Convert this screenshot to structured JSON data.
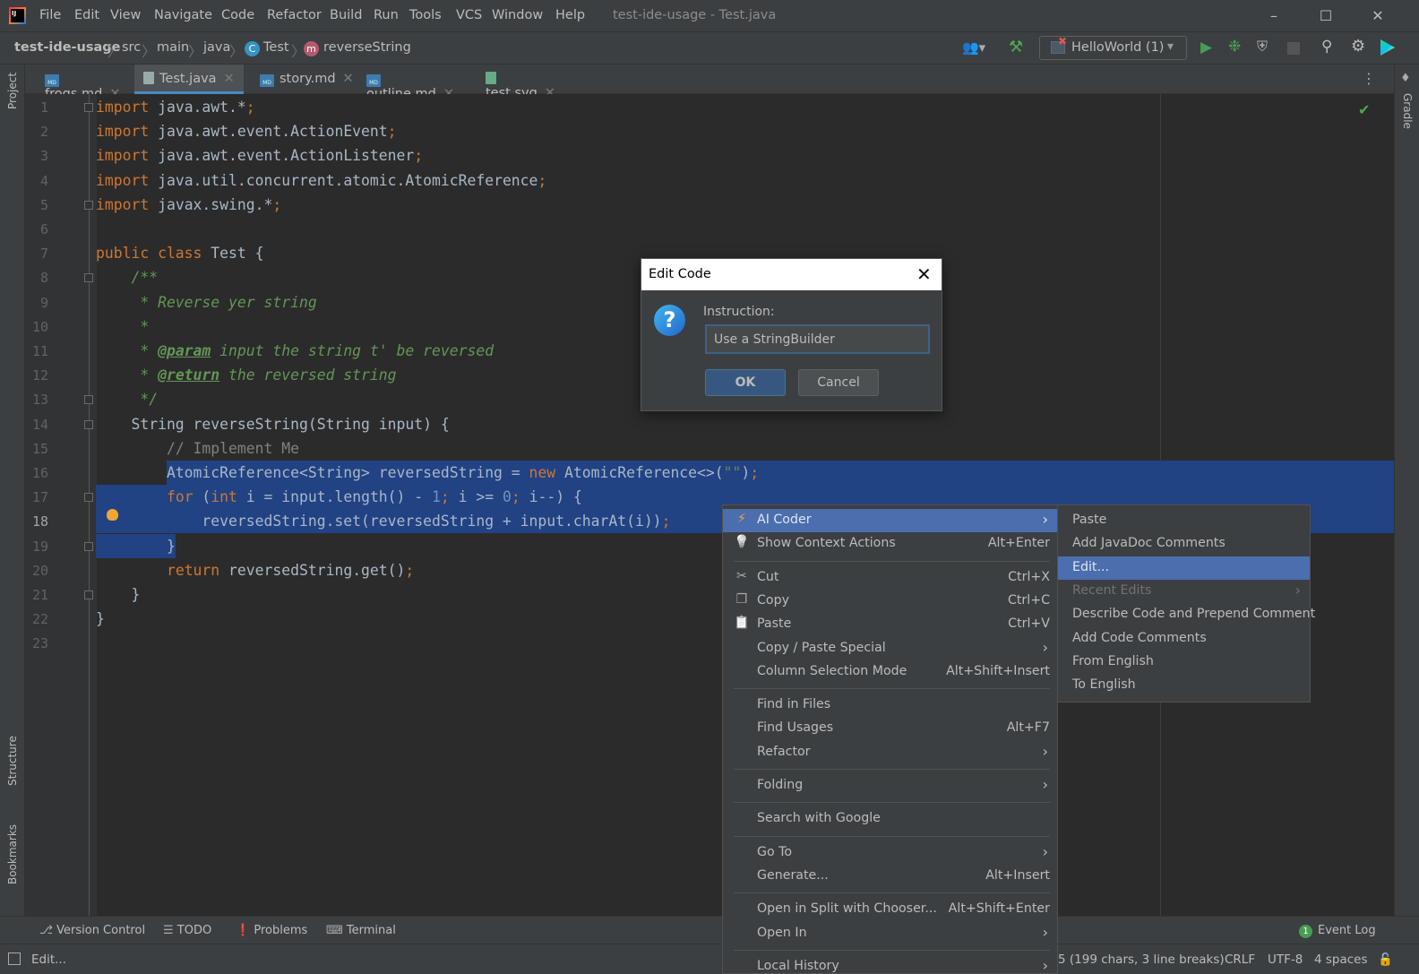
{
  "titlebar": {
    "menus": [
      "File",
      "Edit",
      "View",
      "Navigate",
      "Code",
      "Refactor",
      "Build",
      "Run",
      "Tools",
      "VCS",
      "Window",
      "Help"
    ],
    "title": "test-ide-usage - Test.java",
    "logo": "IJ"
  },
  "breadcrumb": {
    "project": "test-ide-usage",
    "items": [
      "src",
      "main",
      "java"
    ],
    "class_badge": "C",
    "class": "Test",
    "method_badge": "m",
    "method": "reverseString"
  },
  "toolbar": {
    "run_config": "HelloWorld (1)",
    "icons": [
      "user-icon",
      "build-hammer-icon",
      "run-icon",
      "debug-icon",
      "coverage-icon",
      "stop-icon",
      "search-icon",
      "gear-icon",
      "code-with-me-icon"
    ]
  },
  "tabs": [
    {
      "label": "frogs.md",
      "type": "md"
    },
    {
      "label": "Test.java",
      "type": "java",
      "active": true
    },
    {
      "label": "story.md",
      "type": "md"
    },
    {
      "label": "outline.md",
      "type": "md"
    },
    {
      "label": "test.svg",
      "type": "svg"
    }
  ],
  "side": {
    "left_top": "Project",
    "left_mid": "Structure",
    "left_bottom": "Bookmarks",
    "right": "Gradle"
  },
  "editor": {
    "current_line": 18,
    "lines": [
      [
        [
          "kw",
          "import"
        ],
        [
          "p",
          " java.awt.*"
        ],
        [
          "kw",
          ";"
        ]
      ],
      [
        [
          "kw",
          "import"
        ],
        [
          "p",
          " java.awt.event.ActionEvent"
        ],
        [
          "kw",
          ";"
        ]
      ],
      [
        [
          "kw",
          "import"
        ],
        [
          "p",
          " java.awt.event.ActionListener"
        ],
        [
          "kw",
          ";"
        ]
      ],
      [
        [
          "kw",
          "import"
        ],
        [
          "p",
          " java.util.concurrent.atomic.AtomicReference"
        ],
        [
          "kw",
          ";"
        ]
      ],
      [
        [
          "kw",
          "import"
        ],
        [
          "p",
          " javax.swing.*"
        ],
        [
          "kw",
          ";"
        ]
      ],
      [],
      [
        [
          "kw",
          "public class"
        ],
        [
          "p",
          " Test {"
        ]
      ],
      [
        [
          "p",
          "    "
        ],
        [
          "doc",
          "/**"
        ]
      ],
      [
        [
          "doc",
          "     * Reverse yer string"
        ]
      ],
      [
        [
          "doc",
          "     *"
        ]
      ],
      [
        [
          "doc",
          "     * "
        ],
        [
          "tag",
          "@param"
        ],
        [
          "doc",
          " input the string t' be reversed"
        ]
      ],
      [
        [
          "doc",
          "     * "
        ],
        [
          "tag",
          "@return"
        ],
        [
          "doc",
          " the reversed string"
        ]
      ],
      [
        [
          "doc",
          "     */"
        ]
      ],
      [
        [
          "p",
          "    String reverseString(String input) {"
        ]
      ],
      [
        [
          "p",
          "        "
        ],
        [
          "cm",
          "// Implement Me"
        ]
      ],
      [
        [
          "p",
          "        AtomicReference<String> reversedString = "
        ],
        [
          "kw",
          "new"
        ],
        [
          "p",
          " AtomicReference<>("
        ],
        [
          "str",
          "\"\""
        ],
        [
          "p",
          ")"
        ],
        [
          "kw",
          ";"
        ]
      ],
      [
        [
          "p",
          "        "
        ],
        [
          "kw",
          "for"
        ],
        [
          "p",
          " ("
        ],
        [
          "kw",
          "int"
        ],
        [
          "p",
          " i = input.length() - "
        ],
        [
          "num",
          "1"
        ],
        [
          "kw",
          ";"
        ],
        [
          "p",
          " i >= "
        ],
        [
          "num",
          "0"
        ],
        [
          "kw",
          ";"
        ],
        [
          "p",
          " i--) {"
        ]
      ],
      [
        [
          "p",
          "            reversedString.set(reversedString + input.charAt(i))"
        ],
        [
          "kw",
          ";"
        ]
      ],
      [
        [
          "p",
          "        }"
        ]
      ],
      [
        [
          "p",
          "        "
        ],
        [
          "kw",
          "return"
        ],
        [
          "p",
          " reversedString.get()"
        ],
        [
          "kw",
          ";"
        ]
      ],
      [
        [
          "p",
          "    }"
        ]
      ],
      [
        [
          "p",
          "}"
        ]
      ],
      []
    ]
  },
  "dialog": {
    "title": "Edit Code",
    "label": "Instruction:",
    "value": "Use a StringBuilder",
    "ok": "OK",
    "cancel": "Cancel"
  },
  "context_menu": [
    {
      "label": "AI Coder",
      "icon": "lightning-icon",
      "submenu": true,
      "highlighted": true
    },
    {
      "label": "Show Context Actions",
      "icon": "bulb-icon",
      "shortcut": "Alt+Enter"
    },
    {
      "sep": true
    },
    {
      "label": "Cut",
      "icon": "scissors-icon",
      "shortcut": "Ctrl+X"
    },
    {
      "label": "Copy",
      "icon": "copy-icon",
      "shortcut": "Ctrl+C"
    },
    {
      "label": "Paste",
      "icon": "clipboard-icon",
      "shortcut": "Ctrl+V"
    },
    {
      "label": "Copy / Paste Special",
      "submenu": true
    },
    {
      "label": "Column Selection Mode",
      "shortcut": "Alt+Shift+Insert"
    },
    {
      "sep": true
    },
    {
      "label": "Find in Files"
    },
    {
      "label": "Find Usages",
      "shortcut": "Alt+F7"
    },
    {
      "label": "Refactor",
      "submenu": true
    },
    {
      "sep": true
    },
    {
      "label": "Folding",
      "submenu": true
    },
    {
      "sep": true
    },
    {
      "label": "Search with Google"
    },
    {
      "sep": true
    },
    {
      "label": "Go To",
      "submenu": true
    },
    {
      "label": "Generate...",
      "shortcut": "Alt+Insert"
    },
    {
      "sep": true
    },
    {
      "label": "Open in Split with Chooser...",
      "shortcut": "Alt+Shift+Enter"
    },
    {
      "label": "Open In",
      "submenu": true
    },
    {
      "sep": true
    },
    {
      "label": "Local History",
      "submenu": true
    }
  ],
  "submenu": [
    {
      "label": "Paste"
    },
    {
      "label": "Add JavaDoc Comments"
    },
    {
      "label": "Edit...",
      "highlighted": true
    },
    {
      "label": "Recent Edits",
      "disabled": true,
      "submenu": true
    },
    {
      "label": "Describe Code and Prepend Comment"
    },
    {
      "label": "Add Code Comments"
    },
    {
      "label": "From English"
    },
    {
      "label": "To English"
    }
  ],
  "tool_windows": [
    {
      "label": "Version Control",
      "icon": "git-branch-icon"
    },
    {
      "label": "TODO",
      "icon": "list-icon"
    },
    {
      "label": "Problems",
      "icon": "warning-icon"
    },
    {
      "label": "Terminal",
      "icon": "terminal-icon"
    }
  ],
  "event_log": {
    "label": "Event Log",
    "count": "1"
  },
  "status": {
    "message": "Edit...",
    "selection": "5 (199 chars, 3 line breaks)",
    "line_sep": "CRLF",
    "encoding": "UTF-8",
    "indent": "4 spaces"
  },
  "colors": {
    "accent": "#4b6eaf",
    "selection": "#214283",
    "keyword": "#cc7832",
    "doc": "#629755",
    "number": "#6897bb",
    "string": "#6a8759"
  }
}
